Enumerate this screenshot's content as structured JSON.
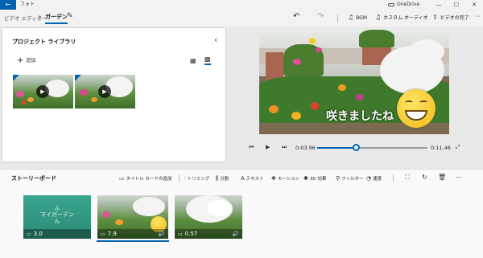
{
  "titlebar": {
    "back_glyph": "←",
    "app_title": "フォト",
    "onedrive_label": "OneDrive",
    "minimize_glyph": "—",
    "maximize_glyph": "☐",
    "close_glyph": "✕"
  },
  "navbar": {
    "breadcrumb_editor": "ビデオ エディター",
    "breadcrumb_sep": "›",
    "project_name": "ガーデン",
    "rename_glyph": "✎",
    "undo_glyph": "↶",
    "redo_glyph": "↷",
    "bgm": {
      "icon": "music-note-icon",
      "glyph": "♫",
      "label": "BGM"
    },
    "custom_audio": {
      "icon": "custom-audio-icon",
      "glyph": "♫",
      "label": "カスタム オーディオ"
    },
    "finish_video": {
      "icon": "export-icon",
      "glyph": "⇪",
      "label": "ビデオの完了"
    },
    "more_glyph": "⋯"
  },
  "library": {
    "title": "プロジェクト ライブラリ",
    "collapse_glyph": "‹",
    "add": {
      "glyph": "+",
      "label": "追加"
    },
    "view_small_glyph": "▦",
    "view_large_glyph": "▩",
    "thumbnails": [
      {
        "name": "clip-1",
        "play_glyph": "▶"
      },
      {
        "name": "clip-2",
        "play_glyph": "▶"
      }
    ]
  },
  "preview": {
    "caption": "咲きましたね"
  },
  "playback": {
    "rewind_glyph": "⏮",
    "play_glyph": "▶",
    "forward_glyph": "⏭",
    "current_time": "0:03.96",
    "total_time": "0:11.46",
    "progress_fraction": 0.35,
    "fullscreen_glyph": "⤢"
  },
  "storyboard": {
    "title": "ストーリーボード",
    "tools": [
      {
        "name": "title-card",
        "glyph": "▭",
        "label": "タイトル カードの追加"
      },
      {
        "name": "trim",
        "glyph": "⫶",
        "label": "トリミング"
      },
      {
        "name": "split",
        "glyph": "⫼",
        "label": "分割"
      },
      {
        "name": "text",
        "glyph": "A",
        "label": "テキスト"
      },
      {
        "name": "motion",
        "glyph": "✥",
        "label": "モーション"
      },
      {
        "name": "3d-effects",
        "glyph": "✺",
        "label": "3D 効果"
      },
      {
        "name": "filters",
        "glyph": "⚲",
        "label": "フィルター"
      },
      {
        "name": "speed",
        "glyph": "◔",
        "label": "速度"
      }
    ],
    "resize_glyph": "⛶",
    "rotate_glyph": "↻",
    "delete_glyph": "🗑",
    "more_glyph": "⋯",
    "cards": [
      {
        "type": "title",
        "title_line1": "ふ",
        "title_line2": "マイガーデン",
        "title_line3": "ん",
        "duration": "3.0",
        "footer_glyph": "▭"
      },
      {
        "type": "video",
        "duration": "7.9",
        "footer_glyph": "▭",
        "audio_glyph": "🔊",
        "selected": true
      },
      {
        "type": "video",
        "duration": "0.57",
        "footer_glyph": "▭",
        "audio_glyph": "🔊",
        "selected": false
      }
    ]
  }
}
